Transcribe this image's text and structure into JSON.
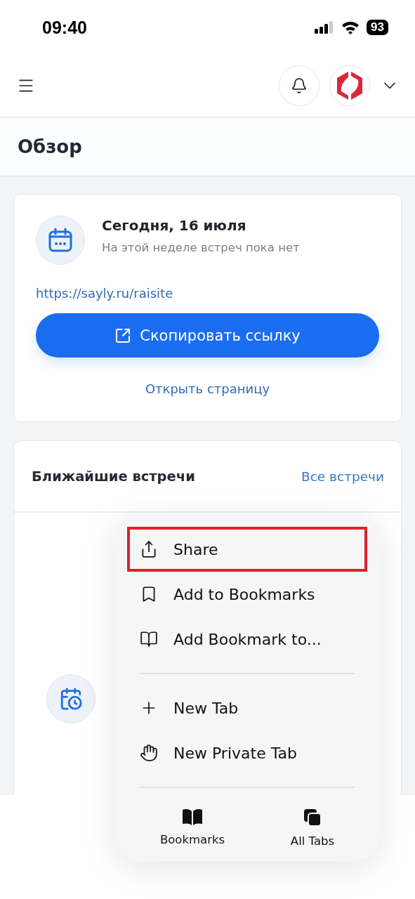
{
  "status_bar": {
    "time": "09:40",
    "battery": "93"
  },
  "page_title": "Обзор",
  "overview_card": {
    "date": "Сегодня, 16 июля",
    "subtitle": "На этой неделе встреч пока нет",
    "link": "https://sayly.ru/raisite",
    "copy_button": "Скопировать ссылку",
    "open_link": "Открыть страницу"
  },
  "meetings_card": {
    "title": "Ближайшие встречи",
    "all_link": "Все встречи"
  },
  "context_menu": {
    "groups": [
      [
        {
          "label": "Share",
          "highlighted": true
        },
        {
          "label": "Add to Bookmarks",
          "highlighted": false
        },
        {
          "label": "Add Bookmark to...",
          "highlighted": false
        }
      ],
      [
        {
          "label": "New Tab",
          "highlighted": false
        },
        {
          "label": "New Private Tab",
          "highlighted": false
        }
      ]
    ],
    "bottom_actions": [
      {
        "label": "Bookmarks"
      },
      {
        "label": "All Tabs"
      }
    ]
  }
}
